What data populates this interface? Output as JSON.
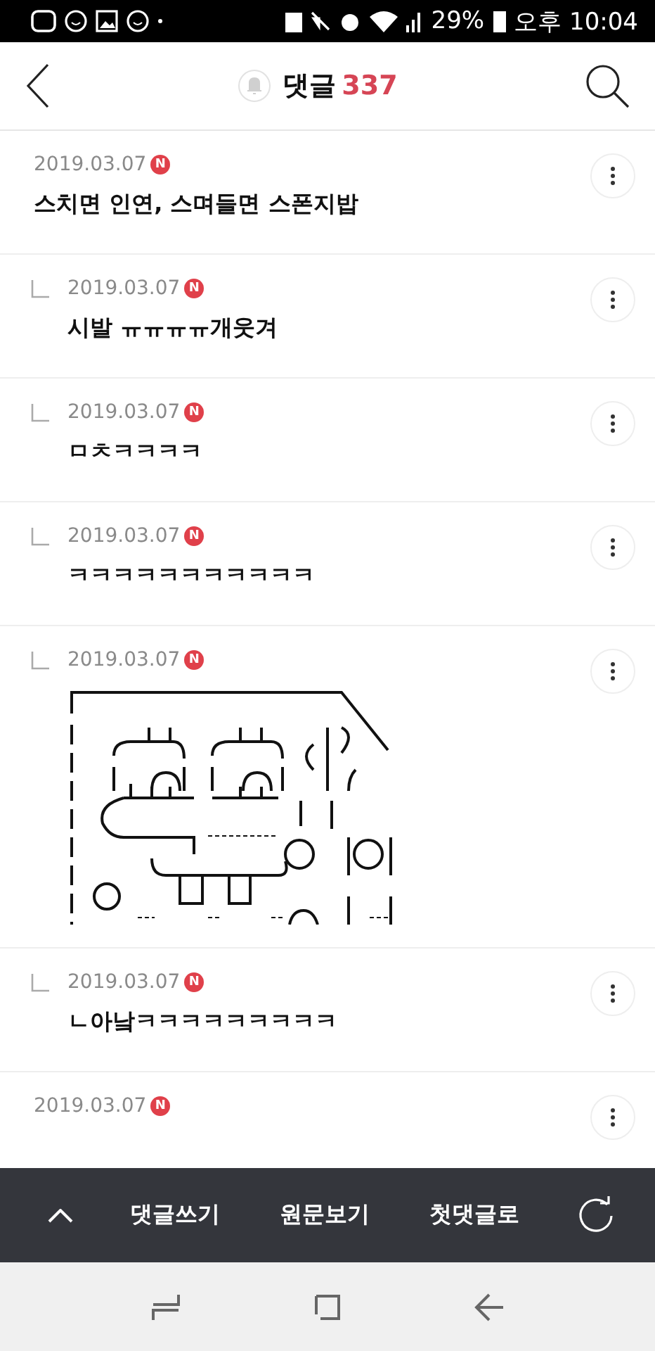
{
  "status_bar": {
    "battery": "29%",
    "time": "오후 10:04"
  },
  "header": {
    "title": "댓글",
    "count": "337"
  },
  "comments": [
    {
      "kind": "text",
      "reply": false,
      "date": "2019.03.07",
      "badge": "N",
      "text": "스치면 인연, 스며들면 스폰지밥"
    },
    {
      "kind": "text",
      "reply": true,
      "date": "2019.03.07",
      "badge": "N",
      "text": "시발 ㅠㅠㅠㅠ개웃겨"
    },
    {
      "kind": "text",
      "reply": true,
      "date": "2019.03.07",
      "badge": "N",
      "text": "ㅁㅊㅋㅋㅋㅋ"
    },
    {
      "kind": "text",
      "reply": true,
      "date": "2019.03.07",
      "badge": "N",
      "text": "ㅋㅋㅋㅋㅋㅋㅋㅋㅋㅋㅋ"
    },
    {
      "kind": "art",
      "reply": true,
      "date": "2019.03.07",
      "badge": "N"
    },
    {
      "kind": "text",
      "reply": true,
      "date": "2019.03.07",
      "badge": "N",
      "text": "ㄴ아낰ㅋㅋㅋㅋㅋㅋㅋㅋㅋ"
    },
    {
      "kind": "text",
      "reply": false,
      "date": "2019.03.07",
      "badge": "N"
    }
  ],
  "bottom_bar": {
    "items": [
      "댓글쓰기",
      "원문보기",
      "첫댓글로"
    ]
  }
}
